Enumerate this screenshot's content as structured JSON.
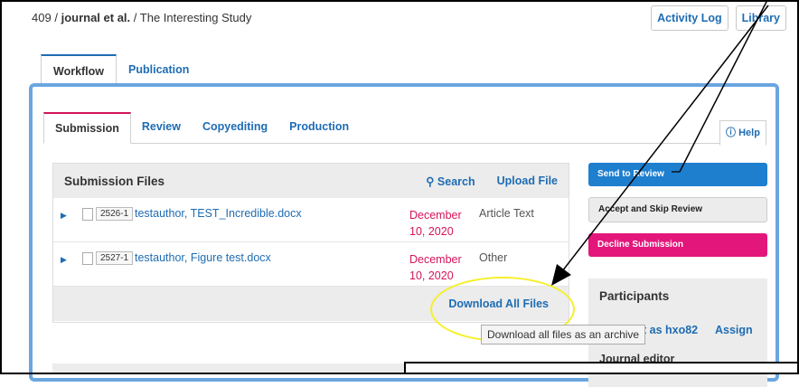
{
  "breadcrumb": {
    "id": "409",
    "sep1": "/",
    "author": "journal et al.",
    "sep2": "/",
    "title": "The Interesting Study"
  },
  "top_actions": {
    "activity_log": "Activity Log",
    "library": "Library"
  },
  "outer_tabs": {
    "workflow": "Workflow",
    "publication": "Publication"
  },
  "inner_tabs": {
    "submission": "Submission",
    "review": "Review",
    "copyediting": "Copyediting",
    "production": "Production"
  },
  "help": {
    "label": "Help",
    "icon": "info-icon"
  },
  "files": {
    "title": "Submission Files",
    "search_label": "Search",
    "upload_label": "Upload File",
    "rows": [
      {
        "id": "2526-1",
        "name": "testauthor, TEST_Incredible.docx",
        "date_line1": "December",
        "date_line2": "10, 2020",
        "genre": "Article Text"
      },
      {
        "id": "2527-1",
        "name": "testauthor, Figure test.docx",
        "date_line1": "December",
        "date_line2": "10, 2020",
        "genre": "Other"
      }
    ],
    "download_all": "Download All Files",
    "tooltip": "Download all files as an archive"
  },
  "actions": {
    "send_to_review": "Send to Review",
    "accept_skip": "Accept and Skip Review",
    "decline": "Decline Submission"
  },
  "participants": {
    "title": "Participants",
    "login_as": "t as hxo82",
    "assign": "Assign",
    "role": "Journal editor"
  },
  "colors": {
    "link_blue": "#1e6cb3",
    "accent_pink": "#d4145a",
    "highlight_yellow": "#f5f02a"
  }
}
